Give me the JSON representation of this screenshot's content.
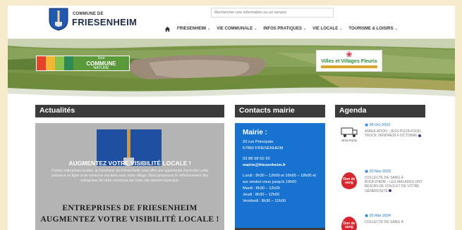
{
  "header": {
    "logo_small": "COMMUNE DE",
    "logo_big": "FRIESENHEIM",
    "search_placeholder": "Rechercher une information ou un service",
    "nav": [
      "FRIESENHEIM",
      "VIE COMMUNALE",
      "INFOS PRATIQUES",
      "VIE LOCALE",
      "TOURISME & LOISIRS"
    ]
  },
  "banner": {
    "nature_line1": "Une",
    "nature_line2": "COMMUNE",
    "nature_line3": "NATURE",
    "villes_title": "Villes et Villages Fleuris"
  },
  "sections": {
    "actualites": "Actualités",
    "contacts": "Contacts mairie",
    "agenda": "Agenda"
  },
  "actualite": {
    "title": "AUGMENTEZ VOTRE VISIBILITÉ LOCALE !",
    "description": "Chères entreprises locales, la Commune de Friesenheim vous offre une opportunité d'accroître votre présence en ligne et de renforcer vos liens avec notre village. Nous proposons le référencement des entreprises de notre commune sur notre site internet municipal.",
    "big1": "ENTREPRISES DE FRIESENHEIM",
    "big2": "AUGMENTEZ VOTRE VISIBILITÉ LOCALE !"
  },
  "contact": {
    "title": "Mairie :",
    "address1": "20 rue Principale",
    "address2": "67860 FRIESENHEIM",
    "phone": "03 88 58 50 20",
    "email": "mairie@friesenheim.fr",
    "hours1": "Lundi : 8h30 – 12h00 et 16h00 – 18h00 et sur rendez-vous jusqu'à 19h00",
    "hours2": "Mardi : 8h30 – 12h00",
    "hours3": "Jeudi : 8h30 – 12h00",
    "hours4": "Vendredi : 8h30 – 12h00"
  },
  "agenda": [
    {
      "date": "06 Oct 2023",
      "text": "ANNULATION : JESS PIZZA FOOD TRUCK VENDREDI 6 OCTOBRE",
      "thumb": "JESS PIZZA"
    },
    {
      "date": "20 Nov 2023",
      "text": "COLLECTE DE SANG À BOOFZHEIM – LES MALADES ONT BESOIN DE VOUS ET DE VOTRE GÉNÉROSITÉ",
      "thumb": "Don de sang"
    },
    {
      "date": "05 Mar 2024",
      "text": "COLLECTE DE SANG À",
      "thumb": "Don de sang"
    }
  ],
  "colors": {
    "accent_blue": "#1773cf",
    "section_header": "#3b3b3b",
    "page_bg": "#f6eccb"
  }
}
